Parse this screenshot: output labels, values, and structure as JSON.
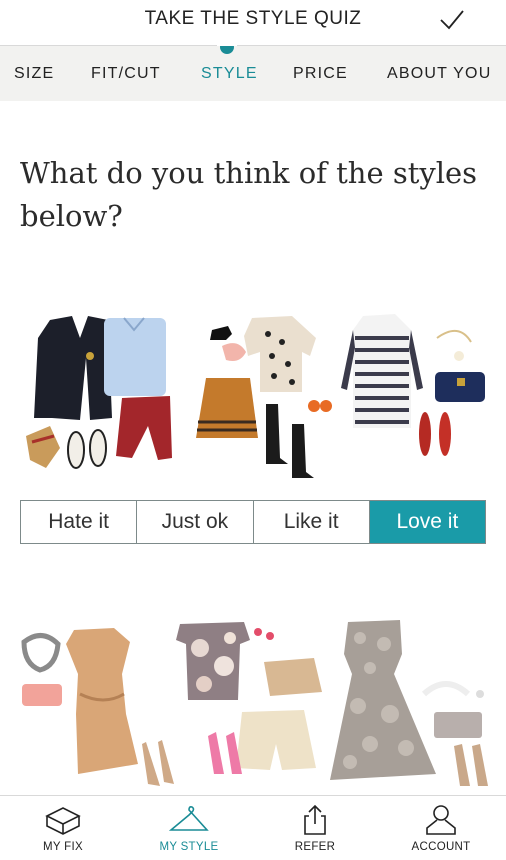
{
  "header": {
    "title": "TAKE THE STYLE QUIZ",
    "done_icon": "checkmark-icon"
  },
  "tabs": [
    {
      "label": "SIZE",
      "active": false
    },
    {
      "label": "FIT/CUT",
      "active": false
    },
    {
      "label": "STYLE",
      "active": true
    },
    {
      "label": "PRICE",
      "active": false
    },
    {
      "label": "ABOUT YOU",
      "active": false
    }
  ],
  "question": "What do you think of the styles below?",
  "rating": {
    "options": [
      "Hate it",
      "Just ok",
      "Like it",
      "Love it"
    ],
    "selected": "Love it"
  },
  "colors": {
    "accent": "#1a9ba8",
    "tab_bg": "#f2f2f0"
  },
  "bottom_nav": [
    {
      "label": "MY FIX",
      "icon": "box-icon",
      "active": false
    },
    {
      "label": "MY STYLE",
      "icon": "hanger-icon",
      "active": true
    },
    {
      "label": "REFER",
      "icon": "share-icon",
      "active": false
    },
    {
      "label": "ACCOUNT",
      "icon": "person-icon",
      "active": false
    }
  ]
}
